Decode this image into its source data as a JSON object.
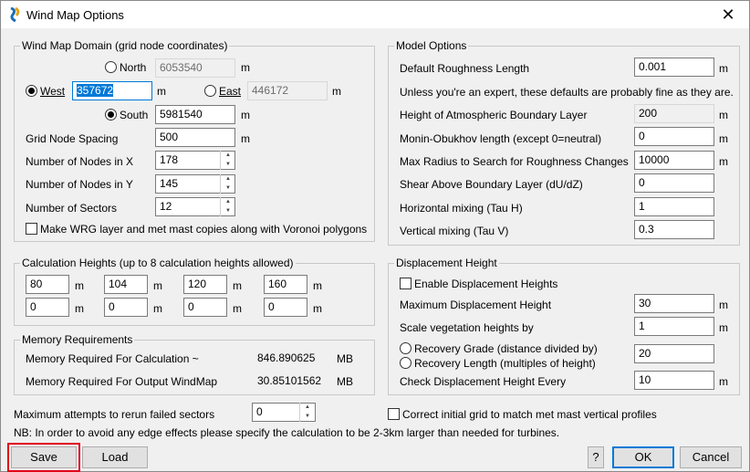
{
  "window": {
    "title": "Wind Map Options",
    "close_glyph": "✕"
  },
  "domain": {
    "legend": "Wind Map Domain (grid node coordinates)",
    "north": {
      "label": "North",
      "value": "6053540",
      "unit": "m",
      "selected": false
    },
    "west": {
      "label": "West",
      "value": "357672",
      "unit": "m",
      "selected": true
    },
    "east": {
      "label": "East",
      "value": "446172",
      "unit": "m",
      "selected": false
    },
    "south": {
      "label": "South",
      "value": "5981540",
      "unit": "m",
      "selected": true
    },
    "spacing": {
      "label": "Grid Node Spacing",
      "value": "500",
      "unit": "m"
    },
    "nodes_x": {
      "label": "Number of Nodes in X",
      "value": "178"
    },
    "nodes_y": {
      "label": "Number of Nodes in Y",
      "value": "145"
    },
    "sectors": {
      "label": "Number of Sectors",
      "value": "12"
    },
    "wrg_check": {
      "label": "Make WRG layer and met mast copies along with Voronoi polygons",
      "checked": false
    }
  },
  "heights": {
    "legend": "Calculation Heights (up to 8 calculation heights allowed)",
    "unit": "m",
    "values": [
      "80",
      "104",
      "120",
      "160",
      "0",
      "0",
      "0",
      "0"
    ]
  },
  "memory": {
    "legend": "Memory Requirements",
    "calc_label": "Memory Required For Calculation ~",
    "calc_value": "846.890625",
    "output_label": "Memory Required For Output WindMap",
    "output_value": "30.85101562",
    "unit": "MB"
  },
  "retries": {
    "label": "Maximum attempts to rerun failed sectors",
    "value": "0"
  },
  "note": "NB: In order to avoid any edge effects please specify the calculation to be 2-3km larger than needed for turbines.",
  "model": {
    "legend": "Model Options",
    "roughness": {
      "label": "Default Roughness Length",
      "value": "0.001",
      "unit": "m"
    },
    "hint": "Unless you're an expert, these defaults are probably fine as they are.",
    "abl": {
      "label": "Height of Atmospheric Boundary Layer",
      "value": "200",
      "unit": "m"
    },
    "mo": {
      "label": "Monin-Obukhov length (except 0=neutral)",
      "value": "0",
      "unit": "m"
    },
    "radius": {
      "label": "Max Radius to Search for Roughness Changes",
      "value": "10000",
      "unit": "m"
    },
    "shear": {
      "label": "Shear Above Boundary Layer (dU/dZ)",
      "value": "0"
    },
    "tauh": {
      "label": "Horizontal mixing (Tau H)",
      "value": "1"
    },
    "tauv": {
      "label": "Vertical mixing (Tau V)",
      "value": "0.3"
    }
  },
  "displacement": {
    "legend": "Displacement Height",
    "enable": {
      "label": "Enable Displacement Heights",
      "checked": false
    },
    "max": {
      "label": "Maximum Displacement Height",
      "value": "30",
      "unit": "m"
    },
    "scale": {
      "label": "Scale vegetation heights by",
      "value": "1",
      "unit": "m"
    },
    "grade": {
      "label": "Recovery Grade (distance divided by)",
      "value": "20",
      "selected": false
    },
    "length": {
      "label": "Recovery Length (multiples of height)",
      "selected": false
    },
    "check": {
      "label": "Check Displacement Height Every",
      "value": "10",
      "unit": "m"
    }
  },
  "correct": {
    "label": "Correct initial grid to match met mast vertical profiles",
    "checked": false
  },
  "buttons": {
    "save": "Save",
    "load": "Load",
    "help": "?",
    "ok": "OK",
    "cancel": "Cancel"
  },
  "colors": {
    "accent": "#0078d7",
    "highlight": "#e0001b"
  }
}
